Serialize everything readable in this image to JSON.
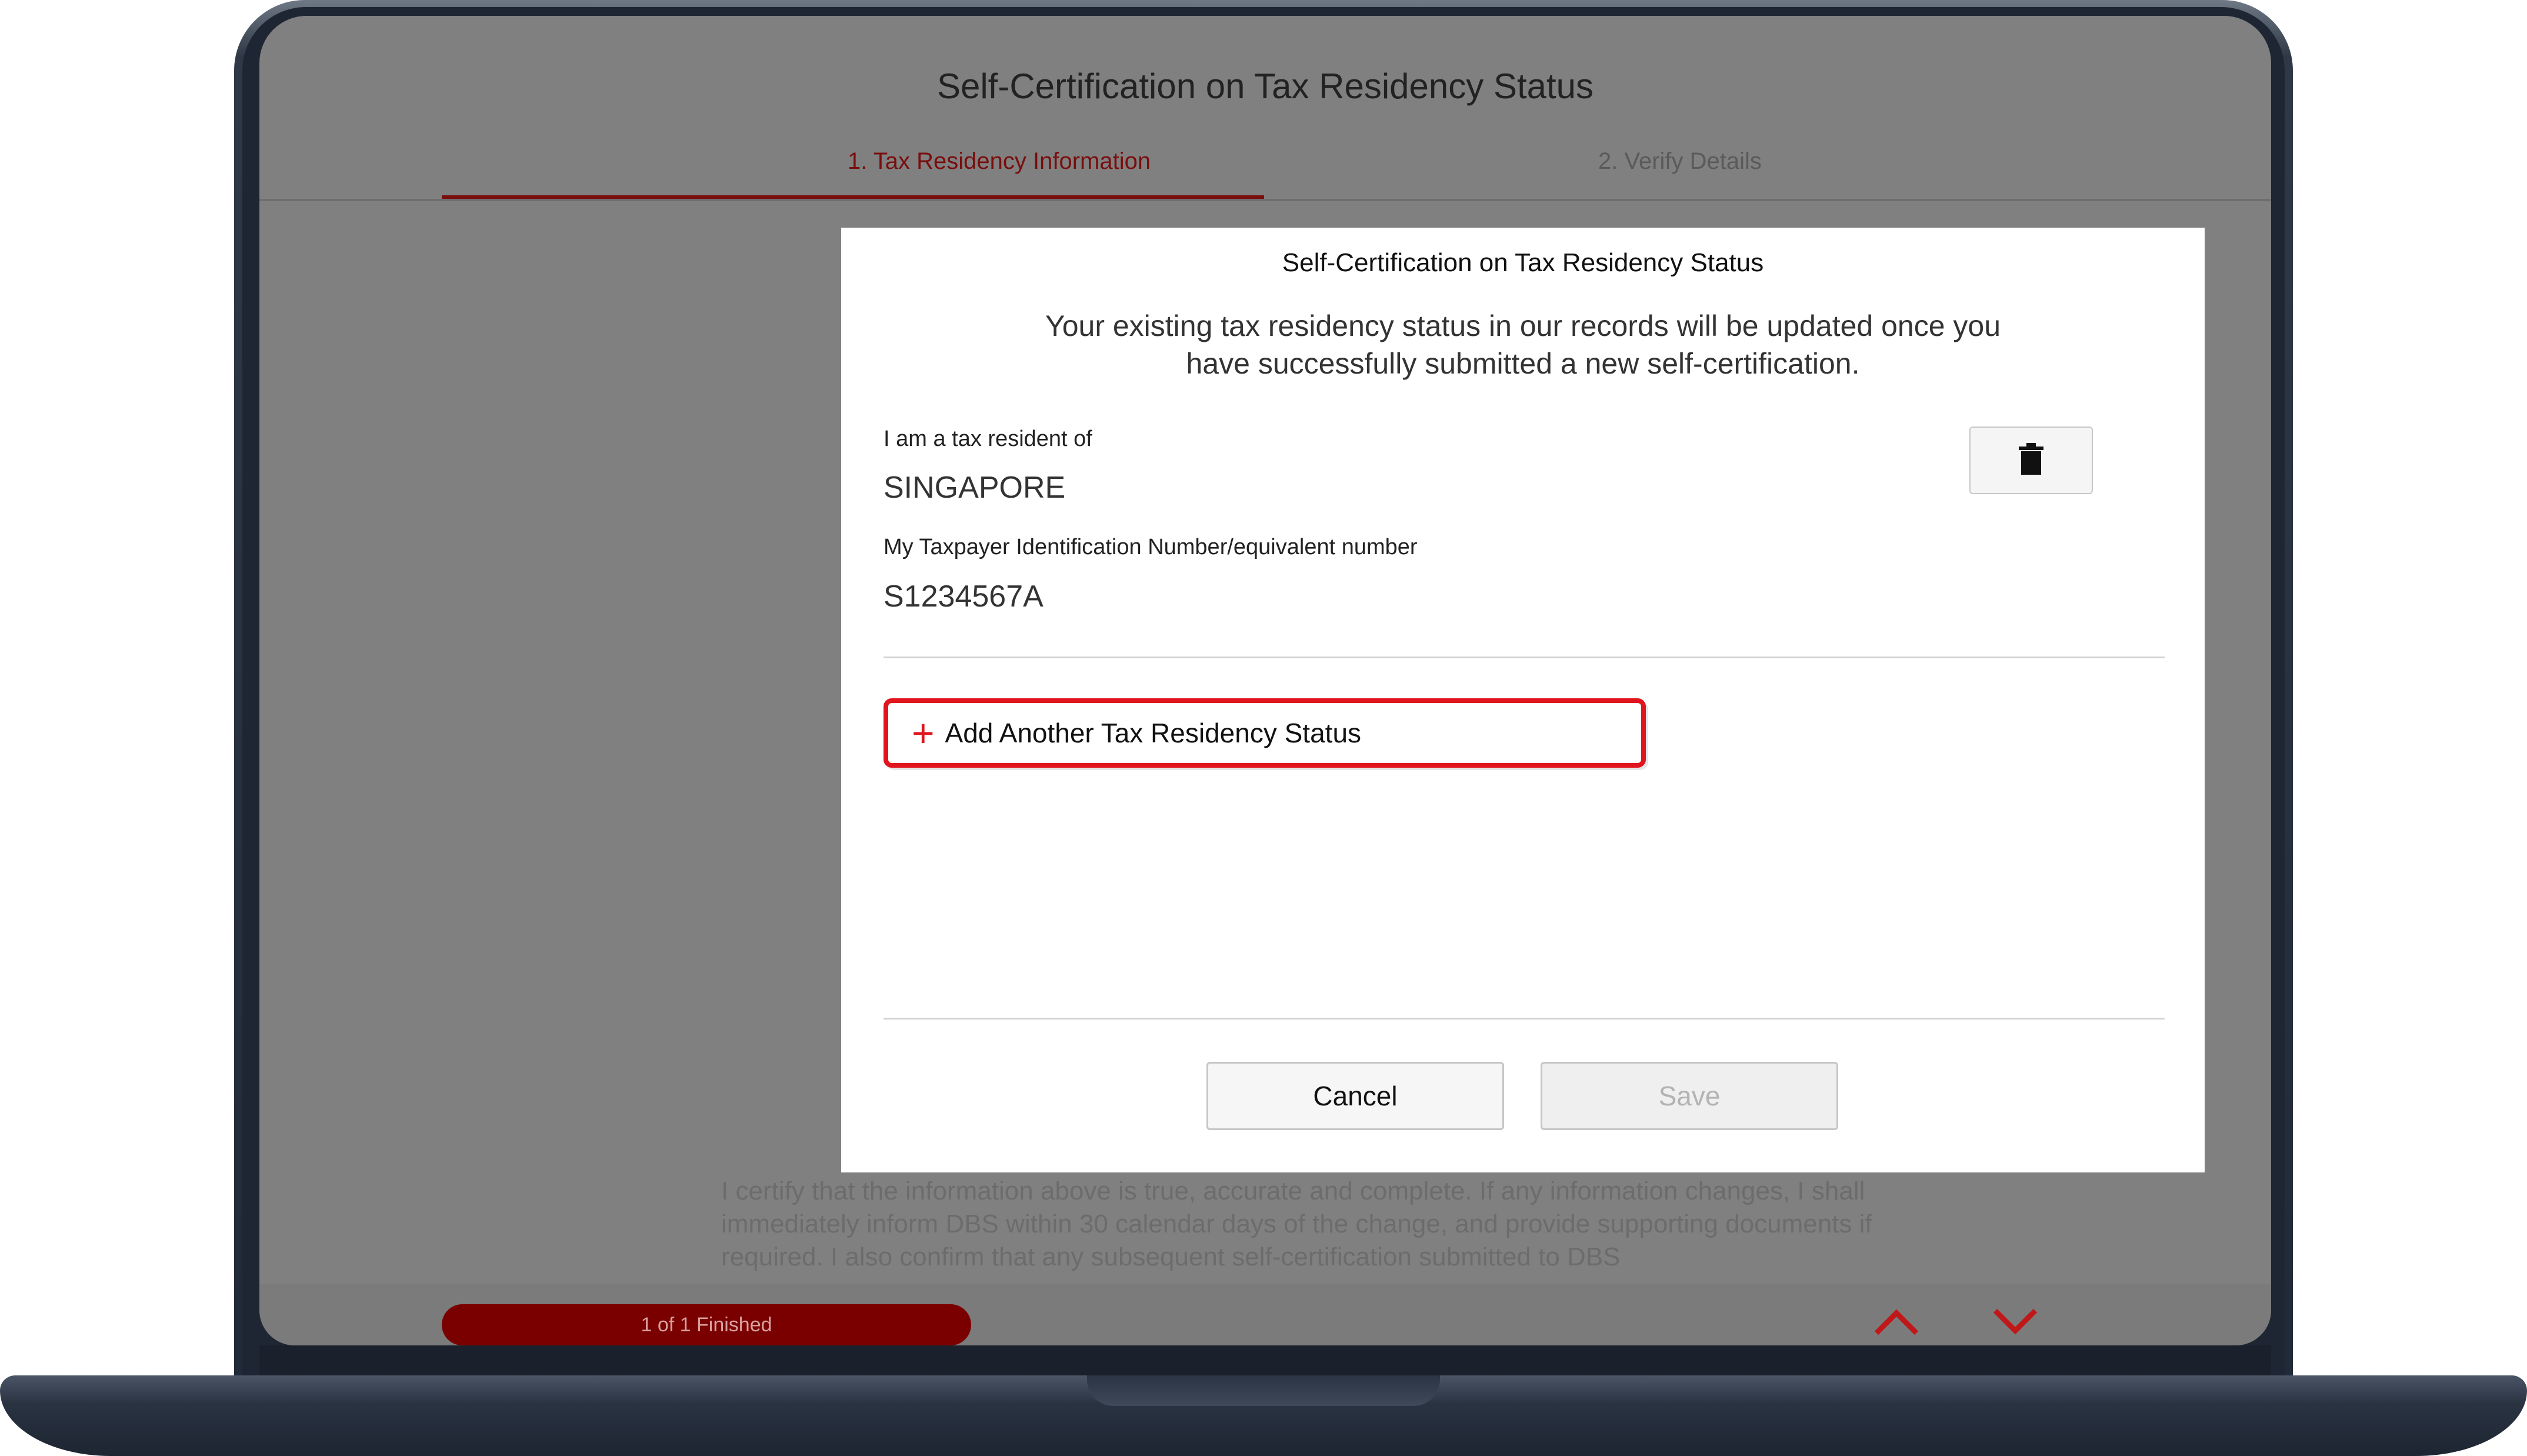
{
  "app": {
    "title": "Self-Certification on Tax Residency Status",
    "steps": [
      {
        "label": "1.  Tax Residency Information",
        "active": true
      },
      {
        "label": "2. Verify Details",
        "active": false
      }
    ],
    "certify_text": "I certify that the information above is true, accurate and complete. If any information changes, I shall immediately inform DBS within 30 calendar days of the change, and provide supporting documents if required. I also confirm that any subsequent self-certification submitted to DBS",
    "progress_label": "1 of 1 Finished",
    "nav_up_icon": "chevron-up-icon",
    "nav_down_icon": "chevron-down-icon",
    "accent_color": "#e0151d"
  },
  "modal": {
    "title": "Self-Certification on Tax Residency Status",
    "description": "Your existing tax residency status in our records will be updated once you have successfully submitted a new self-certification.",
    "residency": {
      "country_label": "I am a tax resident of",
      "country_value": "SINGAPORE",
      "tin_label": "My Taxpayer Identification Number/equivalent number",
      "tin_value": "S1234567A",
      "delete_icon": "trash-icon"
    },
    "add_button_label": "Add Another Tax Residency Status",
    "cancel_label": "Cancel",
    "save_label": "Save"
  }
}
